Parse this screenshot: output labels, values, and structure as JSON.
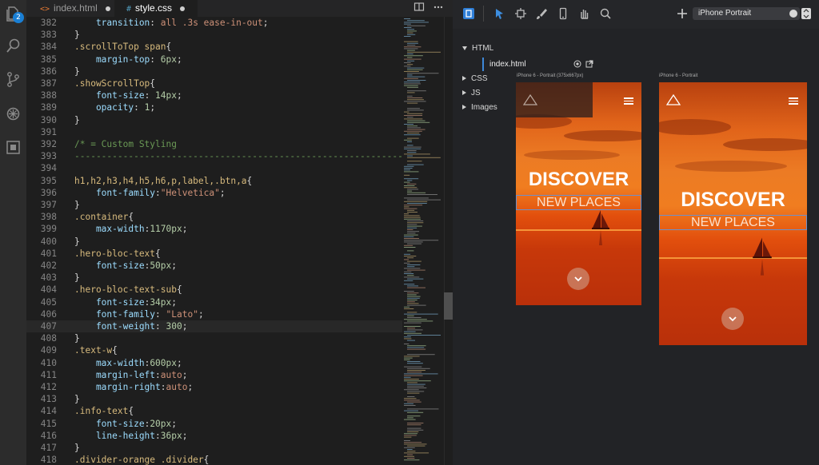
{
  "activity_bar": {
    "badge_count": "2"
  },
  "tabs": [
    {
      "icon": "<>",
      "label": "index.html",
      "modified": true
    },
    {
      "icon": "#",
      "label": "style.css",
      "modified": true
    }
  ],
  "code_lines": [
    {
      "n": "382",
      "text": "    transition: all .3s ease-in-out;"
    },
    {
      "n": "383",
      "text": "}"
    },
    {
      "n": "384",
      "text": ".scrollToTop span{"
    },
    {
      "n": "385",
      "text": "    margin-top: 6px;"
    },
    {
      "n": "386",
      "text": "}"
    },
    {
      "n": "387",
      "text": ".showScrollTop{"
    },
    {
      "n": "388",
      "text": "    font-size: 14px;"
    },
    {
      "n": "389",
      "text": "    opacity: 1;"
    },
    {
      "n": "390",
      "text": "}"
    },
    {
      "n": "391",
      "text": ""
    },
    {
      "n": "392",
      "text": "/* = Custom Styling"
    },
    {
      "n": "393",
      "text": "-------------------------------------------------------------- */"
    },
    {
      "n": "394",
      "text": ""
    },
    {
      "n": "395",
      "text": "h1,h2,h3,h4,h5,h6,p,label,.btn,a{"
    },
    {
      "n": "396",
      "text": "    font-family:\"Helvetica\";"
    },
    {
      "n": "397",
      "text": "}"
    },
    {
      "n": "398",
      "text": ".container{"
    },
    {
      "n": "399",
      "text": "    max-width:1170px;"
    },
    {
      "n": "400",
      "text": "}"
    },
    {
      "n": "401",
      "text": ".hero-bloc-text{"
    },
    {
      "n": "402",
      "text": "    font-size:50px;"
    },
    {
      "n": "403",
      "text": "}"
    },
    {
      "n": "404",
      "text": ".hero-bloc-text-sub{"
    },
    {
      "n": "405",
      "text": "    font-size:34px;"
    },
    {
      "n": "406",
      "text": "    font-family: \"Lato\";"
    },
    {
      "n": "407",
      "text": "    font-weight: 300;"
    },
    {
      "n": "408",
      "text": "}"
    },
    {
      "n": "409",
      "text": ".text-w{"
    },
    {
      "n": "410",
      "text": "    max-width:600px;"
    },
    {
      "n": "411",
      "text": "    margin-left:auto;"
    },
    {
      "n": "412",
      "text": "    margin-right:auto;"
    },
    {
      "n": "413",
      "text": "}"
    },
    {
      "n": "414",
      "text": ".info-text{"
    },
    {
      "n": "415",
      "text": "    font-size:20px;"
    },
    {
      "n": "416",
      "text": "    line-height:36px;"
    },
    {
      "n": "417",
      "text": "}"
    },
    {
      "n": "418",
      "text": ".divider-orange .divider{"
    }
  ],
  "current_line": "407",
  "preview": {
    "device_select": "iPhone Portrait",
    "tree": {
      "html": "HTML",
      "file": "index.html",
      "css": "CSS",
      "js": "JS",
      "images": "Images"
    },
    "device_left_label": "iPhone 6 - Portrait (375x667px)",
    "device_right_label": "iPhone 6 - Portrait",
    "hero_title": "DISCOVER",
    "hero_sub": "NEW PLACES"
  },
  "colors": {
    "accent": "#1a7fd4",
    "selector": "#d7ba7d",
    "property": "#9cdcfe",
    "number": "#b5cea8",
    "string": "#ce9178",
    "comment": "#6a9955"
  }
}
